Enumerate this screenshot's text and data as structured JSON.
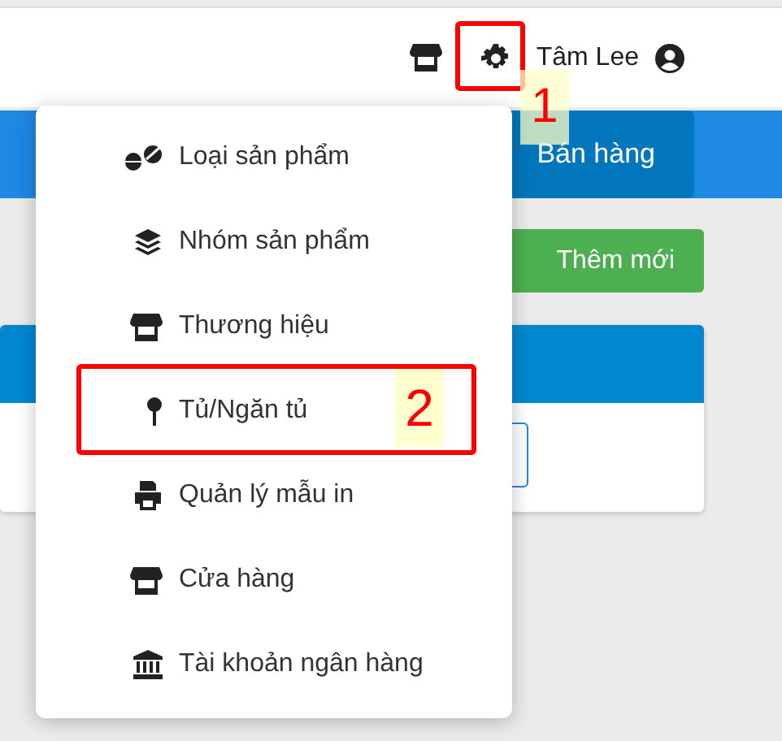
{
  "header": {
    "user_name": "Tâm Lee",
    "settings_annotation": "1"
  },
  "toolbar": {
    "sell_button": "Bán hàng"
  },
  "content": {
    "add_button": "Thêm mới"
  },
  "settings_menu": {
    "items": [
      {
        "label": "Loại sản phẩm",
        "kind": "pills"
      },
      {
        "label": "Nhóm sản phẩm",
        "kind": "layers"
      },
      {
        "label": "Thương hiệu",
        "kind": "store"
      },
      {
        "label": "Tủ/Ngăn tủ",
        "kind": "pin",
        "annotation": "2"
      },
      {
        "label": "Quản lý mẫu in",
        "kind": "printer"
      },
      {
        "label": "Cửa hàng",
        "kind": "store"
      },
      {
        "label": "Tài khoản ngân hàng",
        "kind": "bank"
      }
    ]
  }
}
